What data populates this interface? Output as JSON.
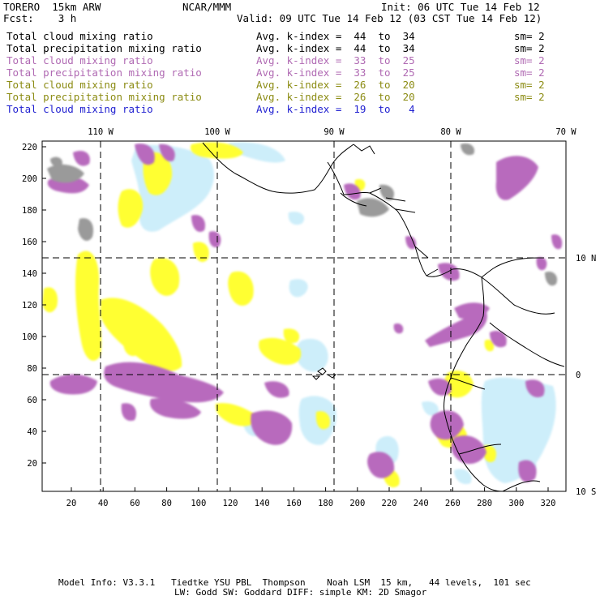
{
  "header": {
    "model": "TORERO  15km ARW",
    "org": "NCAR/MMM",
    "init": "Init: 06 UTC Tue 14 Feb 12",
    "fcst": "Fcst:    3 h",
    "valid": "Valid: 09 UTC Tue 14 Feb 12 (03 CST Tue 14 Feb 12)"
  },
  "legend": [
    {
      "field": "Total cloud mixing ratio",
      "index": "Avg. k-index =  44  to  34",
      "sm": "sm= 2",
      "color": "#000000"
    },
    {
      "field": "Total precipitation mixing ratio",
      "index": "Avg. k-index =  44  to  34",
      "sm": "sm= 2",
      "color": "#000000"
    },
    {
      "field": "Total cloud mixing ratio",
      "index": "Avg. k-index =  33  to  25",
      "sm": "sm= 2",
      "color": "#b06ab3"
    },
    {
      "field": "Total precipitation mixing ratio",
      "index": "Avg. k-index =  33  to  25",
      "sm": "sm= 2",
      "color": "#b06ab3"
    },
    {
      "field": "Total cloud mixing ratio",
      "index": "Avg. k-index =  26  to  20",
      "sm": "sm= 2",
      "color": "#8c8c14"
    },
    {
      "field": "Total precipitation mixing ratio",
      "index": "Avg. k-index =  26  to  20",
      "sm": "sm= 2",
      "color": "#8c8c14"
    },
    {
      "field": "Total cloud mixing ratio",
      "index": "Avg. k-index =  19  to   4",
      "sm": "",
      "color": "#1f1fd0"
    }
  ],
  "axes": {
    "top_lon_labels": [
      "110 W",
      "100 W",
      "90 W",
      "80 W",
      "70 W"
    ],
    "right_lat_labels": [
      "10 N",
      "0",
      "10 S"
    ],
    "left_grid_labels": [
      "220",
      "200",
      "180",
      "160",
      "140",
      "120",
      "100",
      "80",
      "60",
      "40",
      "20"
    ],
    "bottom_grid_labels": [
      "20",
      "40",
      "60",
      "80",
      "100",
      "120",
      "140",
      "160",
      "180",
      "200",
      "220",
      "240",
      "260",
      "280",
      "300",
      "320"
    ]
  },
  "fill_colors": {
    "gray": "#9a9a9a",
    "purple": "#b86bbd",
    "yellow": "#ffff33",
    "lightblue": "#cdeefa"
  },
  "footer": {
    "line1": "Model Info: V3.3.1   Tiedtke YSU PBL  Thompson    Noah LSM  15 km,   44 levels,  101 sec",
    "line2": "LW: Godd SW: Goddard DIFF: simple KM: 2D Smagor"
  }
}
